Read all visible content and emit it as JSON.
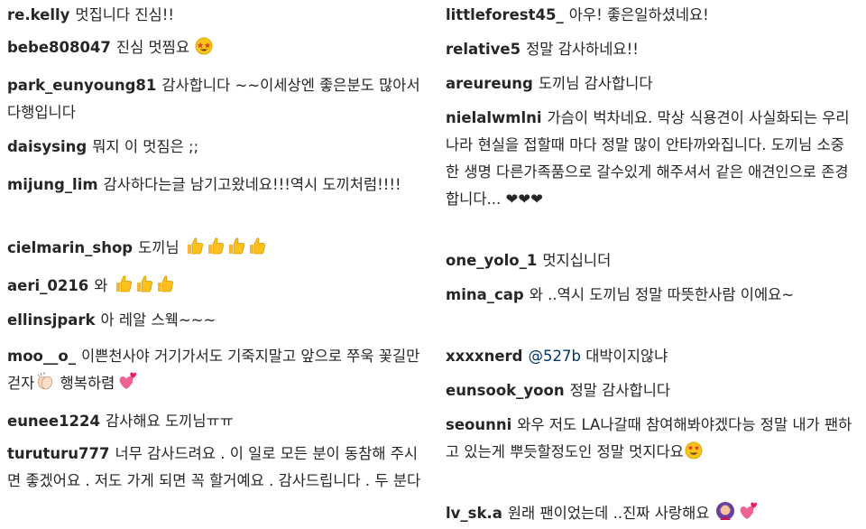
{
  "left_comments": [
    {
      "user": "re.kelly",
      "text": "멋집니다 진심!!"
    },
    {
      "user": "bebe808047",
      "text": "진심 멋찜요",
      "emoji": [
        "star-struck-face-icon"
      ]
    },
    {
      "user": "park_eunyoung81",
      "text": "감사합니다 ~~이세상엔 좋은분도 많아서 다행입니다"
    },
    {
      "user": "daisysing",
      "text": "뭐지 이 멋짐은 ;;"
    },
    {
      "user": "mijung_lim",
      "text": "감사하다는글 남기고왔네요!!!역시 도끼처럼!!!!"
    },
    {
      "user": "cielmarin_shop",
      "text": "도끼님",
      "emoji": [
        "thumbs-up-icon",
        "thumbs-up-icon",
        "thumbs-up-icon",
        "thumbs-up-icon"
      ]
    },
    {
      "user": "aeri_0216",
      "text": "와",
      "emoji": [
        "thumbs-up-icon",
        "thumbs-up-icon",
        "thumbs-up-icon"
      ]
    },
    {
      "user": "ellinsjpark",
      "text": "아 레알 스웩~~~"
    },
    {
      "user": "moo__o_",
      "text": "이쁜천사야 거기가서도 기죽지말고 앞으로 쭈욱 꽃길만 걷자",
      "text2": "행복하렴",
      "emoji": [
        "clapping-hands-icon"
      ],
      "emoji2": [
        "two-hearts-icon"
      ]
    },
    {
      "user": "eunee1224",
      "text": "감사해요 도끼님ㅠㅠ"
    },
    {
      "user": "turuturu777",
      "text": "너무 감사드려요 . 이 일로 모든 분이 동참해 주시면 좋겠어요 . 저도 가게 되면 꼭 할거예요 . 감사드립니다 . 두 분다"
    }
  ],
  "right_comments": [
    {
      "user": "littleforest45_",
      "text": "아우! 좋은일하셨네요!"
    },
    {
      "user": "relative5",
      "text": "정말 감사하네요!!"
    },
    {
      "user": "areureung",
      "text": "도끼님 감사합니다"
    },
    {
      "user": "nielalwmlni",
      "text": "가슴이 벅차네요. 막상 식용견이 사실화되는 우리나라 현실을 접할때 마다 정말 많이 안타까와집니다. 도끼님 소중한 생명 다른가족품으로 갈수있게 해주셔서 같은 애견인으로 존경합니다... ❤❤❤"
    },
    {
      "user": "one_yolo_1",
      "text": "멋지십니더"
    },
    {
      "user": "mina_cap",
      "text": "와 ..역시 도끼님 정말 따뜻한사람 이에요~"
    },
    {
      "user": "xxxxnerd",
      "mention": "@527b",
      "text": "대박이지않냐"
    },
    {
      "user": "eunsook_yoon",
      "text": "정말 감사합니다"
    },
    {
      "user": "seounni",
      "text": "와우 저도 LA나갈때 참여해봐야겠다능 정말 내가 팬하고 있는게 뿌듯할정도인 정말 멋지다요",
      "emoji": [
        "heart-eyes-face-icon"
      ]
    },
    {
      "user": "lv_sk.a",
      "text": "원래 팬이었는데 ..진짜 사랑해요",
      "emoji": [
        "person-icon",
        "two-hearts-icon"
      ]
    }
  ]
}
